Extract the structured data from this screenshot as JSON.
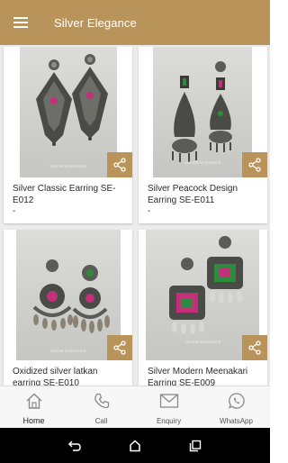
{
  "app": {
    "title": "Silver Elegance"
  },
  "products": [
    {
      "name": "Silver Classic Earring SE-E012",
      "price": "-",
      "watermark": "SILVER ELEGANCE"
    },
    {
      "name": "Silver Peacock Design Earring SE-E011",
      "price": "-",
      "watermark": "SILVER ELEGANCE"
    },
    {
      "name": "Oxidized silver latkan earring SE-E010",
      "price": "-",
      "watermark": "SILVER ELEGANCE"
    },
    {
      "name": "Silver Modern Meenakari Earring SE-E009",
      "price": "-",
      "watermark": "SILVER ELEGANCE"
    }
  ],
  "bottom_nav": [
    {
      "label": "Home",
      "icon": "home-icon",
      "active": true
    },
    {
      "label": "Call",
      "icon": "phone-icon",
      "active": false
    },
    {
      "label": "Enquiry",
      "icon": "mail-icon",
      "active": false
    },
    {
      "label": "WhatsApp",
      "icon": "whatsapp-icon",
      "active": false
    }
  ],
  "colors": {
    "accent": "#b8945a",
    "nav_bg": "#f7f7f7",
    "content_bg": "#ececec"
  }
}
